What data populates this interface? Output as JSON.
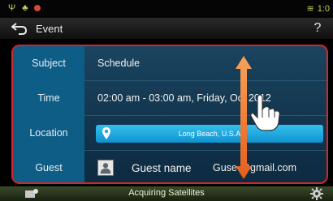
{
  "status": {
    "time": "1:0",
    "icons": [
      "usb-icon",
      "tether-icon",
      "record-icon",
      "wifi-icon"
    ]
  },
  "header": {
    "title": "Event"
  },
  "details": {
    "subject_label": "Subject",
    "subject_value": "Schedule",
    "time_label": "Time",
    "time_value": "02:00 am - 03:00 am, Friday, Oct 2012",
    "location_label": "Location",
    "location_value": "Long Beach, U.S.A",
    "guest_label": "Guest",
    "guest_name": "Guest name",
    "guest_email": "Guse @gmail.com"
  },
  "bottom": {
    "text": "Acquiring Satellites"
  },
  "colors": {
    "label_column": "#0e5d86",
    "panel_bg": "#1a4460",
    "location_button": "#1fa7e0",
    "highlight_border": "#d3262a",
    "gesture_arrow": "#f07a2a"
  }
}
